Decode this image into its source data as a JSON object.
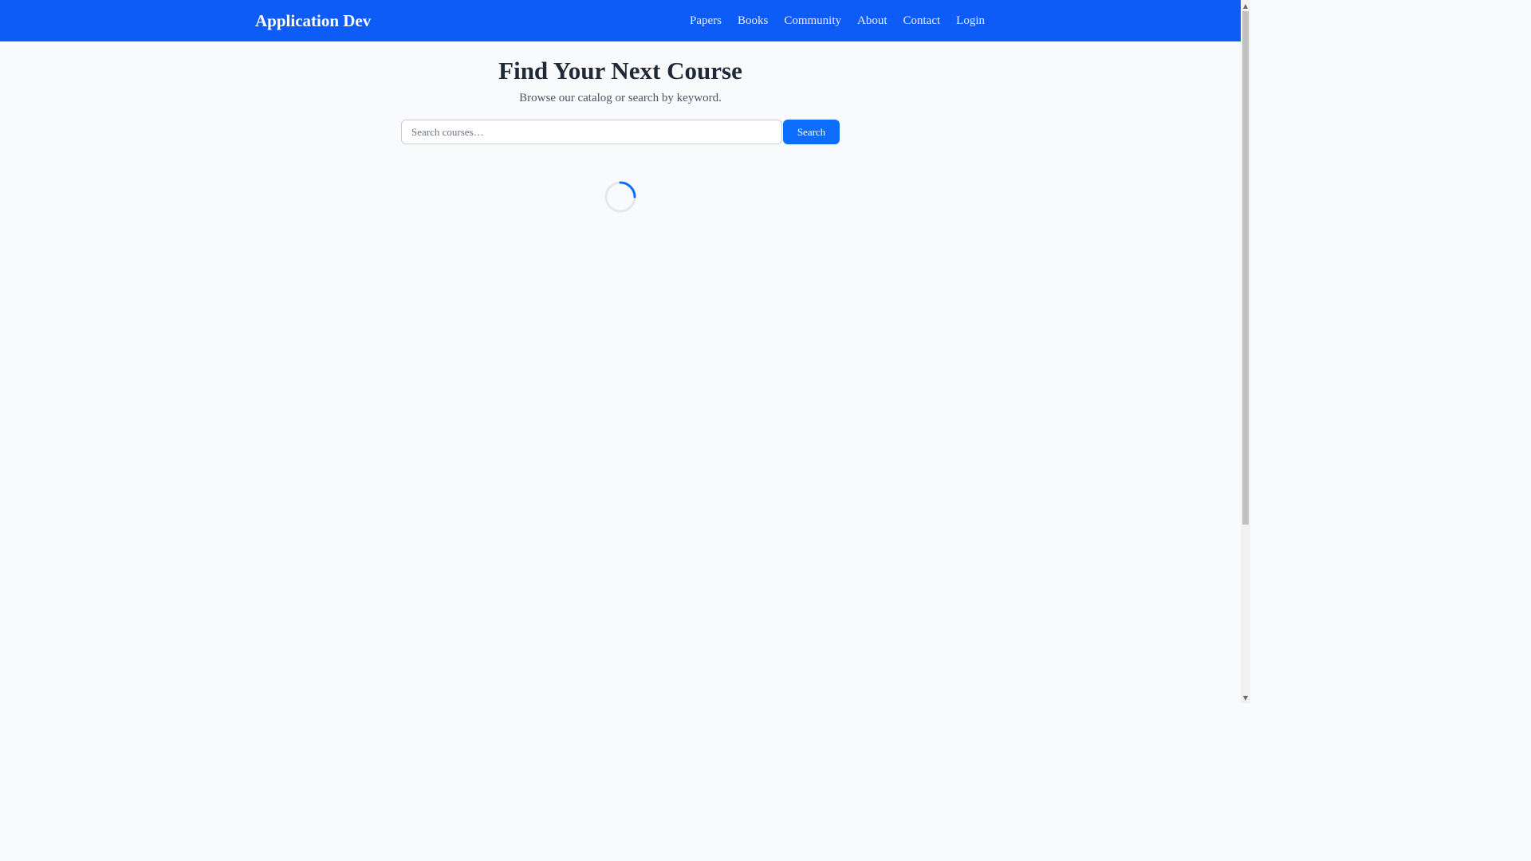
{
  "navbar": {
    "brand": "Application Dev",
    "links": [
      "Papers",
      "Books",
      "Community",
      "About",
      "Contact",
      "Login"
    ],
    "background_color": "#0d5cf7"
  },
  "hero": {
    "title": "Find Your Next Course",
    "subtitle": "Browse our catalog or search by keyword."
  },
  "search": {
    "placeholder": "Search courses…",
    "value": "",
    "button_label": "Search",
    "button_color": "#0d6efd"
  },
  "loading": {
    "icon": "loading-spinner-icon",
    "accent_color": "#0d6efd"
  },
  "scrollbar": {
    "up_icon": "scroll-up-arrow-icon",
    "down_icon": "scroll-down-arrow-icon"
  }
}
